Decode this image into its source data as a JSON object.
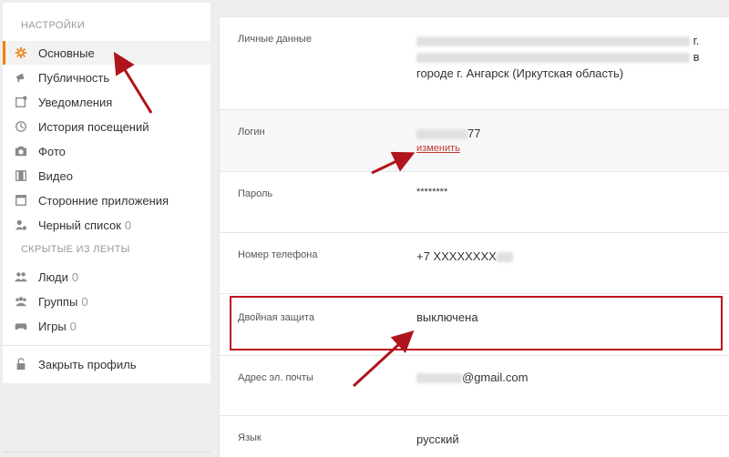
{
  "sidebar": {
    "settings_title": "НАСТРОЙКИ",
    "items": [
      {
        "label": "Основные",
        "icon": "gear-icon",
        "active": true
      },
      {
        "label": "Публичность",
        "icon": "megaphone-icon"
      },
      {
        "label": "Уведомления",
        "icon": "notification-icon"
      },
      {
        "label": "История посещений",
        "icon": "history-icon"
      },
      {
        "label": "Фото",
        "icon": "camera-icon"
      },
      {
        "label": "Видео",
        "icon": "film-icon"
      },
      {
        "label": "Сторонние приложения",
        "icon": "window-icon"
      },
      {
        "label": "Черный список",
        "icon": "user-block-icon",
        "count": "0"
      }
    ],
    "hidden_title": "СКРЫТЫЕ ИЗ ЛЕНТЫ",
    "hidden_items": [
      {
        "label": "Люди",
        "icon": "people-icon",
        "count": "0"
      },
      {
        "label": "Группы",
        "icon": "groups-icon",
        "count": "0"
      },
      {
        "label": "Игры",
        "icon": "gamepad-icon",
        "count": "0"
      }
    ],
    "close_profile": "Закрыть профиль"
  },
  "main": {
    "personal": {
      "label": "Личные данные",
      "suffix1": "г.",
      "suffix2": "в",
      "line3": "городе г. Ангарск (Иркутская область)"
    },
    "login": {
      "label": "Логин",
      "value_suffix": "77",
      "edit": "изменить"
    },
    "password": {
      "label": "Пароль",
      "value": "********"
    },
    "phone": {
      "label": "Номер телефона",
      "value": "+7 XXXXXXXX"
    },
    "two_factor": {
      "label": "Двойная защита",
      "value": "выключена"
    },
    "email": {
      "label": "Адрес эл. почты",
      "value_suffix": "@gmail.com"
    },
    "language": {
      "label": "Язык",
      "value": "русский"
    }
  },
  "colors": {
    "accent": "#ee8208",
    "highlight": "#c0141f",
    "link": "#c0392b"
  }
}
